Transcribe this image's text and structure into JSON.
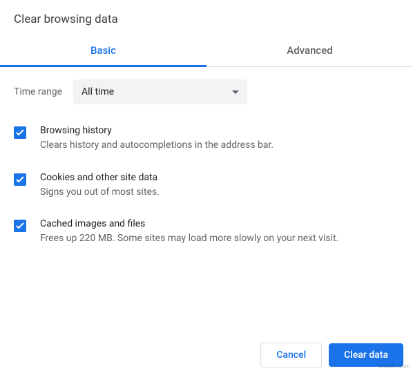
{
  "title": "Clear browsing data",
  "tabs": {
    "basic": "Basic",
    "advanced": "Advanced"
  },
  "time_range": {
    "label": "Time range",
    "value": "All time"
  },
  "options": [
    {
      "title": "Browsing history",
      "desc": "Clears history and autocompletions in the address bar.",
      "checked": true
    },
    {
      "title": "Cookies and other site data",
      "desc": "Signs you out of most sites.",
      "checked": true
    },
    {
      "title": "Cached images and files",
      "desc": "Frees up 220 MB. Some sites may load more slowly on your next visit.",
      "checked": true
    }
  ],
  "buttons": {
    "cancel": "Cancel",
    "clear": "Clear data"
  },
  "watermark": "wsxdn.com"
}
